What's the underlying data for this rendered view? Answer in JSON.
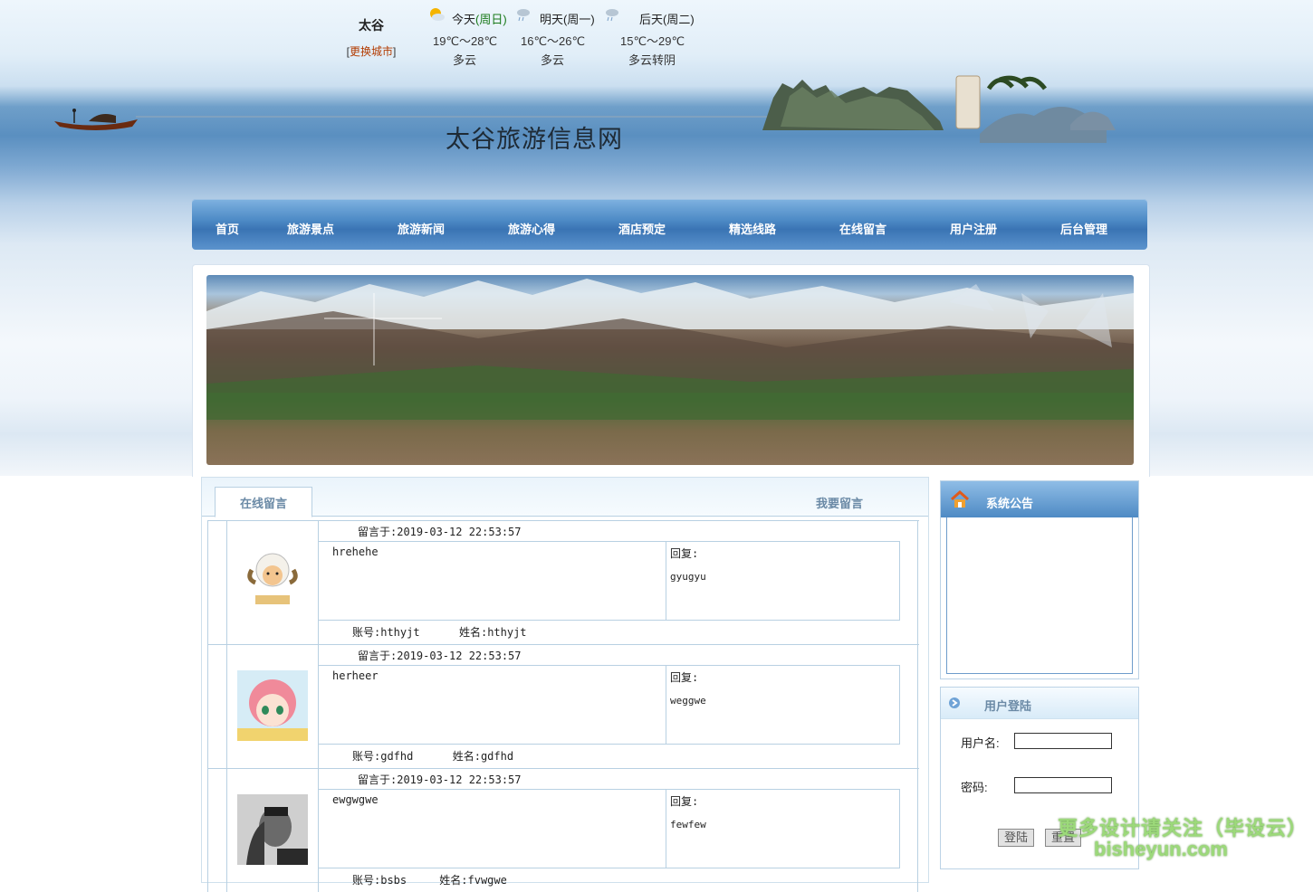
{
  "weather": {
    "city": "太谷",
    "change_city": "更换城市",
    "days": [
      {
        "label": "今天",
        "weekday": "(周日)",
        "temp": "19℃～28℃",
        "desc": "多云",
        "icon": "sun-cloud-icon"
      },
      {
        "label": "明天",
        "weekday": "(周一)",
        "temp": "16℃～26℃",
        "desc": "多云",
        "icon": "rain-cloud-icon"
      },
      {
        "label": "后天",
        "weekday": "(周二)",
        "temp": "15℃～29℃",
        "desc": "多云转阴",
        "icon": "rain-cloud-icon"
      }
    ]
  },
  "site": {
    "title": "太谷旅游信息网"
  },
  "nav": [
    "首页",
    "旅游景点",
    "旅游新闻",
    "旅游心得",
    "酒店预定",
    "精选线路",
    "在线留言",
    "用户注册",
    "后台管理"
  ],
  "board": {
    "tab_active": "在线留言",
    "tab_post": "我要留言",
    "messages": [
      {
        "time": "留言于:2019-03-12 22:53:57",
        "content": "hrehehe",
        "reply_label": "回复:",
        "reply": "gyugyu",
        "account_label": "账号:",
        "account": "hthyjt",
        "name_label": "姓名:",
        "name": "hthyjt",
        "avatar": "sheep-avatar"
      },
      {
        "time": "留言于:2019-03-12 22:53:57",
        "content": "herheer",
        "reply_label": "回复:",
        "reply": "weggwe",
        "account_label": "账号:",
        "account": "gdfhd",
        "name_label": "姓名:",
        "name": "gdfhd",
        "avatar": "anime-girl-avatar"
      },
      {
        "time": "留言于:2019-03-12 22:53:57",
        "content": "ewgwgwe",
        "reply_label": "回复:",
        "reply": "fewfew",
        "account_label": "账号:",
        "account": "bsbs",
        "name_label": "姓名:",
        "name": "fvwgwe",
        "avatar": "man-photo-avatar"
      }
    ]
  },
  "sidebar": {
    "notice_title": "系统公告",
    "login_title": "用户登陆",
    "username_label": "用户名:",
    "password_label": "密码:",
    "login_button": "登陆",
    "reset_button": "重置"
  },
  "watermark": {
    "line1": "更多设计请关注（毕设云）",
    "line2": "bisheyun.com"
  },
  "colors": {
    "nav": "#3a74b4",
    "border": "#b8d0e2",
    "panel_title": "#6b8aa6",
    "watermark": "#9cd97a"
  }
}
